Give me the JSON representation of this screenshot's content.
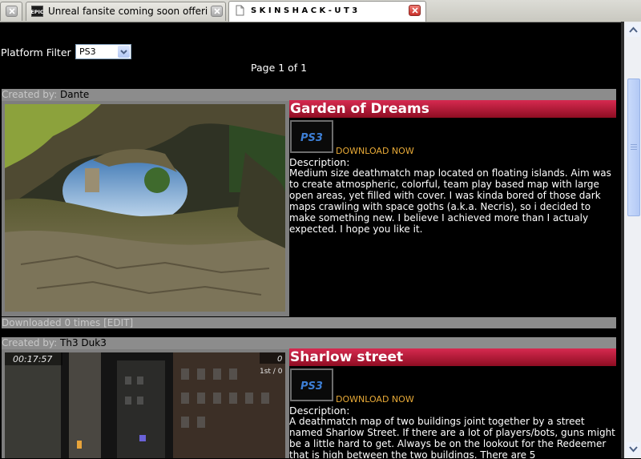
{
  "browser": {
    "tabs": [
      {
        "icon": "epic-games-favicon",
        "label": "Unreal fansite coming soon offering sp...",
        "active": false
      },
      {
        "icon": "page-favicon",
        "label": "S K I N S H A C K - U T 3",
        "active": true
      }
    ]
  },
  "filter": {
    "label": "Platform Filter",
    "selected": "PS3"
  },
  "pager": {
    "text": "Page 1 of 1"
  },
  "maps": [
    {
      "created_by_label": "Created by:",
      "author": "Dante",
      "title": "Garden of Dreams",
      "platform_icon": "ps3-logo",
      "download_label": "DOWNLOAD NOW",
      "description_label": "Description:",
      "description": "Medium size deathmatch map located on floating islands. Aim was to create atmospheric, colorful, team play based map with large open areas, yet filled with cover. I was kinda bored of those dark maps crawling with space goths (a.k.a. Necris), so i decided to make something new. I believe I achieved more than I actualy expected. I hope you like it.",
      "downloads_text": "Downloaded 0 times [EDIT]"
    },
    {
      "created_by_label": "Created by:",
      "author": "Th3 Duk3",
      "title": "Sharlow street",
      "platform_icon": "ps3-logo",
      "download_label": "DOWNLOAD NOW",
      "description_label": "Description:",
      "description": "A deathmatch map of two buildings joint together by a street named Sharlow Street. If there are a lot of players/bots, guns might be a little hard to get. Always be on the lookout for the Redeemer that is high between the two buildings. There are 5",
      "hud": {
        "timer": "00:17:57",
        "score": "0",
        "rank": "1st / 0"
      }
    }
  ],
  "colors": {
    "accent": "#b81838",
    "link": "#e8aa37",
    "bar": "#8c8c8c"
  }
}
